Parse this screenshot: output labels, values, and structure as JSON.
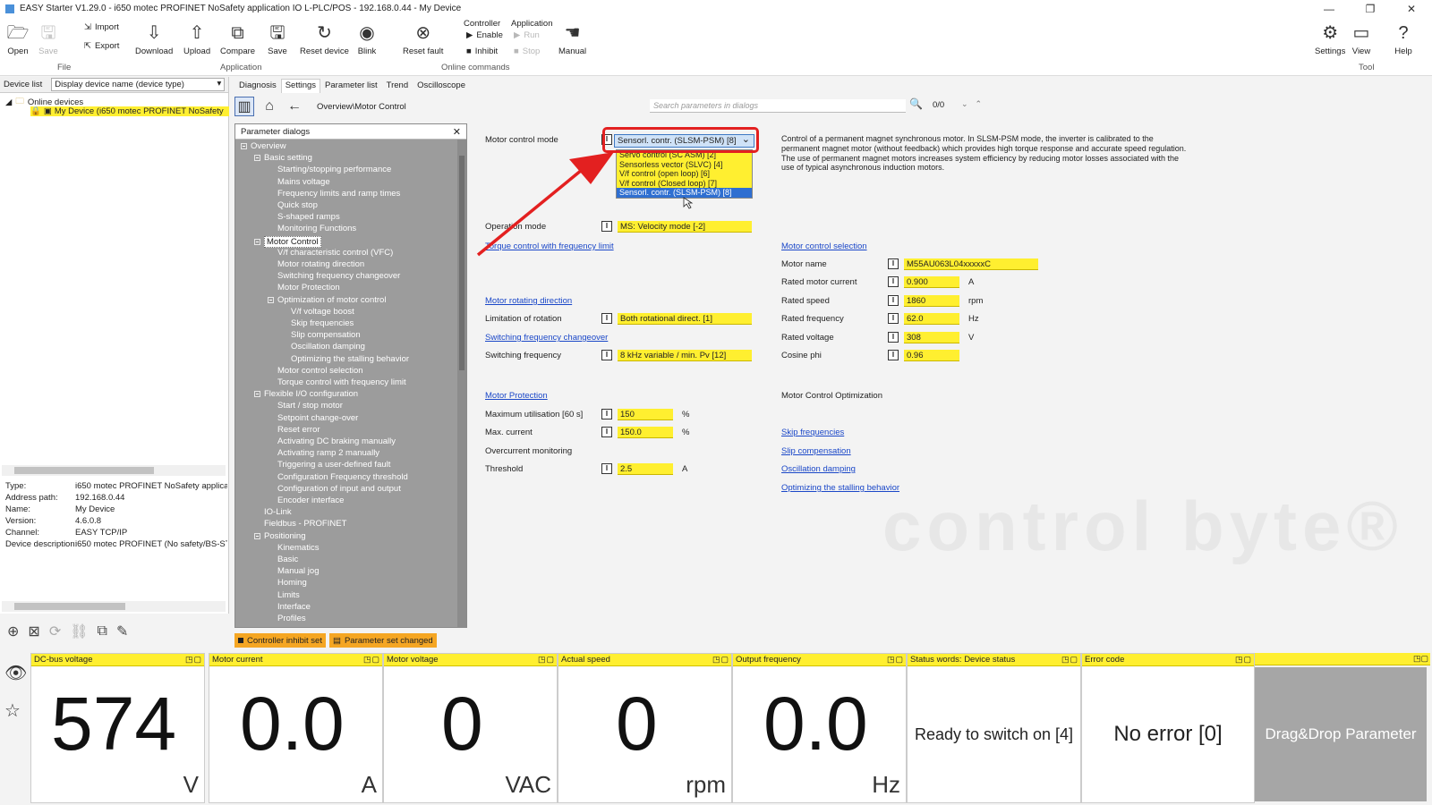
{
  "window": {
    "title": "EASY Starter V1.29.0 - i650 motec PROFINET NoSafety application IO L-PLC/POS - 192.168.0.44 - My Device",
    "controls": [
      "—",
      "❐",
      "✕"
    ]
  },
  "ribbon": {
    "open": "Open",
    "save": "Save",
    "import": "Import",
    "export": "Export",
    "file_group": "File",
    "download": "Download",
    "upload": "Upload",
    "compare": "Compare",
    "save2": "Save",
    "reset_device": "Reset device",
    "application_group": "Application",
    "blink": "Blink",
    "reset_fault": "Reset fault",
    "controller_head": "Controller",
    "application_head": "Application",
    "enable": "Enable",
    "run": "Run",
    "inhibit": "Inhibit",
    "stop": "Stop",
    "manual": "Manual",
    "online_group": "Online commands",
    "settings": "Settings",
    "view": "View",
    "help": "Help",
    "tool_group": "Tool"
  },
  "left_panel": {
    "tab": "Device list",
    "display_select": "Display device name (device type)",
    "tree_root": "Online devices",
    "tree_device": "My Device  (i650 motec PROFINET NoSafety",
    "props": [
      {
        "k": "Type:",
        "v": "i650 motec PROFINET NoSafety applicat"
      },
      {
        "k": "Address path:",
        "v": "192.168.0.44"
      },
      {
        "k": "Name:",
        "v": "My Device"
      },
      {
        "k": "Version:",
        "v": "4.6.0.8"
      },
      {
        "k": "Channel:",
        "v": "EASY TCP/IP"
      },
      {
        "k": "Device description:",
        "v": "i650 motec PROFINET (No safety/BS-ST("
      }
    ]
  },
  "main_tabs": [
    "Diagnosis",
    "Settings",
    "Parameter list",
    "Trend",
    "Oscilloscope"
  ],
  "toolbar": {
    "breadcrumb": "Overview\\Motor Control",
    "search_placeholder": "Search parameters in dialogs",
    "search_count": "0/0"
  },
  "param_dialogs": {
    "title": "Parameter dialogs",
    "close": "✕",
    "nodes": [
      {
        "t": "Overview",
        "lvl": 0,
        "exp": true
      },
      {
        "t": "Basic setting",
        "lvl": 1,
        "exp": true
      },
      {
        "t": "Starting/stopping performance",
        "lvl": 2
      },
      {
        "t": "Mains voltage",
        "lvl": 2
      },
      {
        "t": "Frequency limits and ramp times",
        "lvl": 2
      },
      {
        "t": "Quick stop",
        "lvl": 2
      },
      {
        "t": "S-shaped ramps",
        "lvl": 2
      },
      {
        "t": "Monitoring Functions",
        "lvl": 2
      },
      {
        "t": "Motor Control",
        "lvl": 1,
        "exp": true,
        "sel": true
      },
      {
        "t": "V/f characteristic control (VFC)",
        "lvl": 2
      },
      {
        "t": "Motor rotating direction",
        "lvl": 2
      },
      {
        "t": "Switching frequency changeover",
        "lvl": 2
      },
      {
        "t": "Motor Protection",
        "lvl": 2
      },
      {
        "t": "Optimization of motor control",
        "lvl": 2,
        "exp": true
      },
      {
        "t": "V/f voltage boost",
        "lvl": 3
      },
      {
        "t": "Skip frequencies",
        "lvl": 3
      },
      {
        "t": "Slip compensation",
        "lvl": 3
      },
      {
        "t": "Oscillation damping",
        "lvl": 3
      },
      {
        "t": "Optimizing the stalling behavior",
        "lvl": 3
      },
      {
        "t": "Motor control selection",
        "lvl": 2
      },
      {
        "t": "Torque control with frequency limit",
        "lvl": 2
      },
      {
        "t": "Flexible I/O configuration",
        "lvl": 1,
        "exp": true
      },
      {
        "t": "Start / stop motor",
        "lvl": 2
      },
      {
        "t": "Setpoint change-over",
        "lvl": 2
      },
      {
        "t": "Reset error",
        "lvl": 2
      },
      {
        "t": "Activating DC braking manually",
        "lvl": 2
      },
      {
        "t": "Activating ramp 2 manually",
        "lvl": 2
      },
      {
        "t": "Triggering a user-defined fault",
        "lvl": 2
      },
      {
        "t": "Configuration Frequency threshold",
        "lvl": 2
      },
      {
        "t": "Configuration of input and output",
        "lvl": 2
      },
      {
        "t": "Encoder interface",
        "lvl": 2
      },
      {
        "t": "IO-Link",
        "lvl": 1
      },
      {
        "t": "Fieldbus - PROFINET",
        "lvl": 1
      },
      {
        "t": "Positioning",
        "lvl": 1,
        "exp": true
      },
      {
        "t": "Kinematics",
        "lvl": 2
      },
      {
        "t": "Basic",
        "lvl": 2
      },
      {
        "t": "Manual jog",
        "lvl": 2
      },
      {
        "t": "Homing",
        "lvl": 2
      },
      {
        "t": "Limits",
        "lvl": 2
      },
      {
        "t": "Interface",
        "lvl": 2
      },
      {
        "t": "Profiles",
        "lvl": 2
      }
    ]
  },
  "content": {
    "motor_control_mode_label": "Motor control mode",
    "motor_control_mode_value": "Sensorl. contr. (SLSM-PSM) [8]",
    "dropdown_options": [
      "Servo control (SC ASM) [2]",
      "Sensorless vector (SLVC) [4]",
      "V/f control (open loop) [6]",
      "V/f control (Closed loop) [7]",
      "Sensorl. contr. (SLSM-PSM) [8]"
    ],
    "description": "Control of a permanent magnet synchronous motor. In SLSM-PSM mode, the inverter is calibrated to the permanent magnet motor (without feedback) which provides high torque response and accurate speed regulation. The use of permanent magnet motors increases system efficiency by reducing motor losses associated with the use of typical asynchronous induction motors.",
    "operation_mode_label": "Operation mode",
    "operation_mode_value": "MS: Velocity mode [-2]",
    "torque_link": "Torque control with frequency limit",
    "motor_dir_link": "Motor rotating direction",
    "limitation_label": "Limitation of rotation",
    "limitation_value": "Both rotational direct. [1]",
    "switching_link": "Switching frequency changeover",
    "switching_label": "Switching frequency",
    "switching_value": "8 kHz variable / min. Pv [12]",
    "protection_link": "Motor Protection",
    "max_util_label": "Maximum utilisation [60 s]",
    "max_util_value": "150",
    "max_util_unit": "%",
    "max_current_label": "Max. current",
    "max_current_value": "150.0",
    "max_current_unit": "%",
    "overcurrent_label": "Overcurrent monitoring",
    "threshold_label": "Threshold",
    "threshold_value": "2.5",
    "threshold_unit": "A",
    "motor_sel_link": "Motor control selection",
    "motor_name_label": "Motor name",
    "motor_name_value": "M55AU063L04xxxxxC",
    "rated_current_label": "Rated motor current",
    "rated_current_value": "0.900",
    "rated_current_unit": "A",
    "rated_speed_label": "Rated speed",
    "rated_speed_value": "1860",
    "rated_speed_unit": "rpm",
    "rated_freq_label": "Rated frequency",
    "rated_freq_value": "62.0",
    "rated_freq_unit": "Hz",
    "rated_voltage_label": "Rated voltage",
    "rated_voltage_value": "308",
    "rated_voltage_unit": "V",
    "cosphi_label": "Cosine phi",
    "cosphi_value": "0.96",
    "optimization_label": "Motor Control Optimization",
    "skip_link": "Skip frequencies",
    "slip_link": "Slip compensation",
    "osc_link": "Oscillation damping",
    "stall_link": "Optimizing the stalling behavior",
    "watermark": "control byte®"
  },
  "status": {
    "inhibit": "Controller inhibit set",
    "changed": "Parameter set changed"
  },
  "monitor": {
    "tiles": [
      {
        "h": "DC-bus voltage",
        "v": "574",
        "u": "V"
      },
      {
        "h": "Motor current",
        "v": "0.0",
        "u": "A"
      },
      {
        "h": "Motor voltage",
        "v": "0",
        "u": "VAC"
      },
      {
        "h": "Actual speed",
        "v": "0",
        "u": "rpm"
      },
      {
        "h": "Output frequency",
        "v": "0.0",
        "u": "Hz"
      },
      {
        "h": "Status words: Device status",
        "t": "Ready to switch on [4]"
      },
      {
        "h": "Error code",
        "t": "No error [0]"
      }
    ],
    "drag_drop": "Drag&Drop Parameter"
  },
  "colors": {
    "field_yellow": "#ffef30",
    "link_blue": "#1a47c8",
    "highlight_red": "#e32020",
    "status_orange": "#f5a623",
    "tree_gray": "#9c9c9c"
  }
}
